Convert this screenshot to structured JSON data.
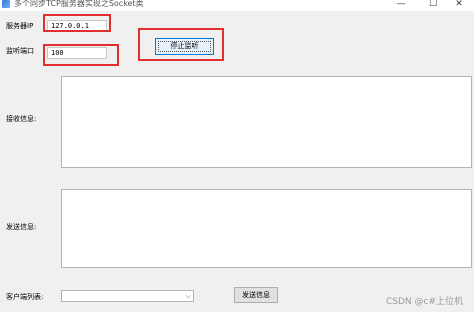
{
  "window": {
    "title": "多个同步TCP服务器实现之Socket类",
    "minimize_glyph": "—",
    "maximize_glyph": "☐",
    "close_glyph": "✕"
  },
  "server": {
    "ip_label": "服务器IP",
    "ip_value": "127.0.0.1",
    "port_label": "监听端口",
    "port_value": "100",
    "stop_button_label": "停止监听"
  },
  "receive": {
    "label": "接收信息:"
  },
  "send": {
    "label": "发送信息:",
    "button_label": "发送信息"
  },
  "clients": {
    "label": "客户端列表:",
    "selected": "",
    "arrow_glyph": "⌵"
  },
  "watermark": "CSDN @c#上位机",
  "colors": {
    "highlight_box": "#e03030",
    "focus_border": "#0078d7"
  }
}
